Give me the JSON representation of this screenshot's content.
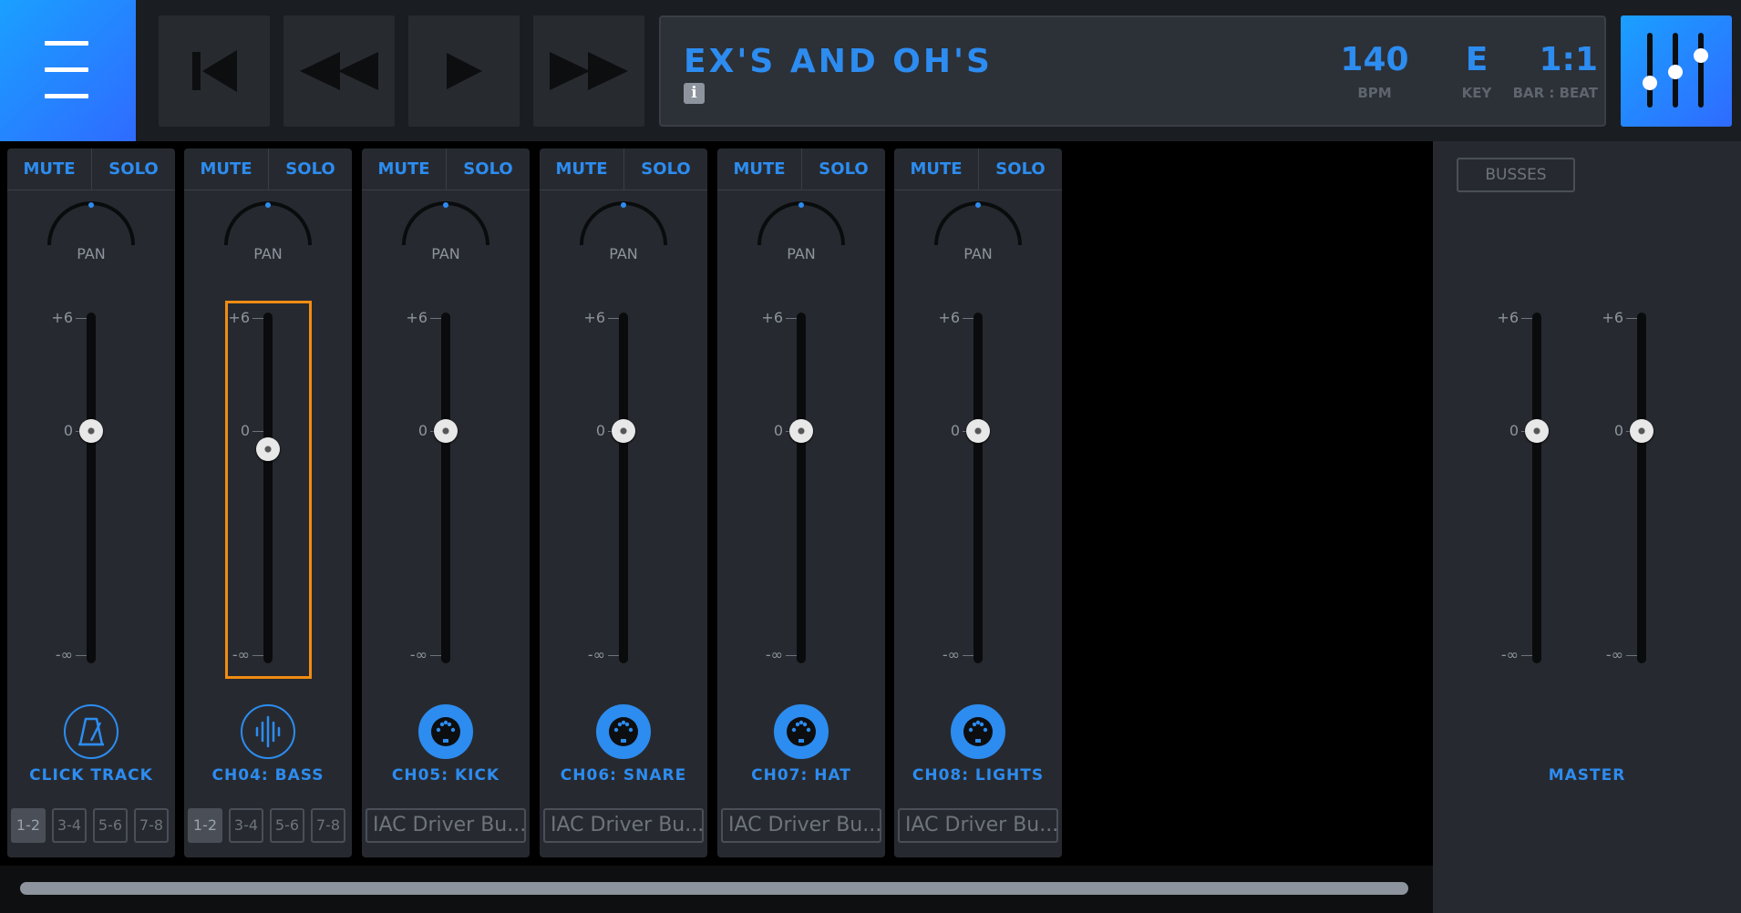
{
  "transport": {
    "menu_icon": "hamburger-icon",
    "buttons": [
      {
        "name": "skip-back-button",
        "icon": "skip-to-start-icon"
      },
      {
        "name": "rewind-button",
        "icon": "rewind-icon"
      },
      {
        "name": "play-button",
        "icon": "play-icon"
      },
      {
        "name": "fast-forward-button",
        "icon": "fast-forward-icon"
      }
    ]
  },
  "display": {
    "song_title": "EX'S AND OH'S",
    "info_label": "i",
    "bpm_value": "140",
    "bpm_label": "BPM",
    "key_value": "E",
    "key_label": "KEY",
    "position_value": "1:1",
    "position_label": "BAR : BEAT"
  },
  "mixer_icon": "mixer-sliders-icon",
  "strip_common": {
    "mute_label": "MUTE",
    "solo_label": "SOLO",
    "pan_label": "PAN",
    "scale_top": "+6",
    "scale_mid": "0",
    "scale_bottom": "-∞"
  },
  "channels": [
    {
      "name": "CLICK TRACK",
      "icon": "metronome-icon",
      "fader_level": 0.5,
      "outputs": [
        "1-2",
        "3-4",
        "5-6",
        "7-8"
      ],
      "active_output": "1-2"
    },
    {
      "name": "CH04: BASS",
      "icon": "waveform-icon",
      "fader_level": 0.46,
      "outputs": [
        "1-2",
        "3-4",
        "5-6",
        "7-8"
      ],
      "active_output": "1-2",
      "highlighted": true
    },
    {
      "name": "CH05: KICK",
      "icon": "midi-port-icon",
      "fader_level": 0.5,
      "output_device": "IAC Driver Bu..."
    },
    {
      "name": "CH06: SNARE",
      "icon": "midi-port-icon",
      "fader_level": 0.5,
      "output_device": "IAC Driver Bu..."
    },
    {
      "name": "CH07: HAT",
      "icon": "midi-port-icon",
      "fader_level": 0.5,
      "output_device": "IAC Driver Bu..."
    },
    {
      "name": "CH08: LIGHTS",
      "icon": "midi-port-icon",
      "fader_level": 0.5,
      "output_device": "IAC Driver Bu..."
    }
  ],
  "master": {
    "busses_label": "BUSSES",
    "label": "MASTER",
    "fader_levels": [
      0.5,
      0.5
    ]
  },
  "colors": {
    "accent": "#2d8cf0",
    "highlight": "#f28c12"
  }
}
